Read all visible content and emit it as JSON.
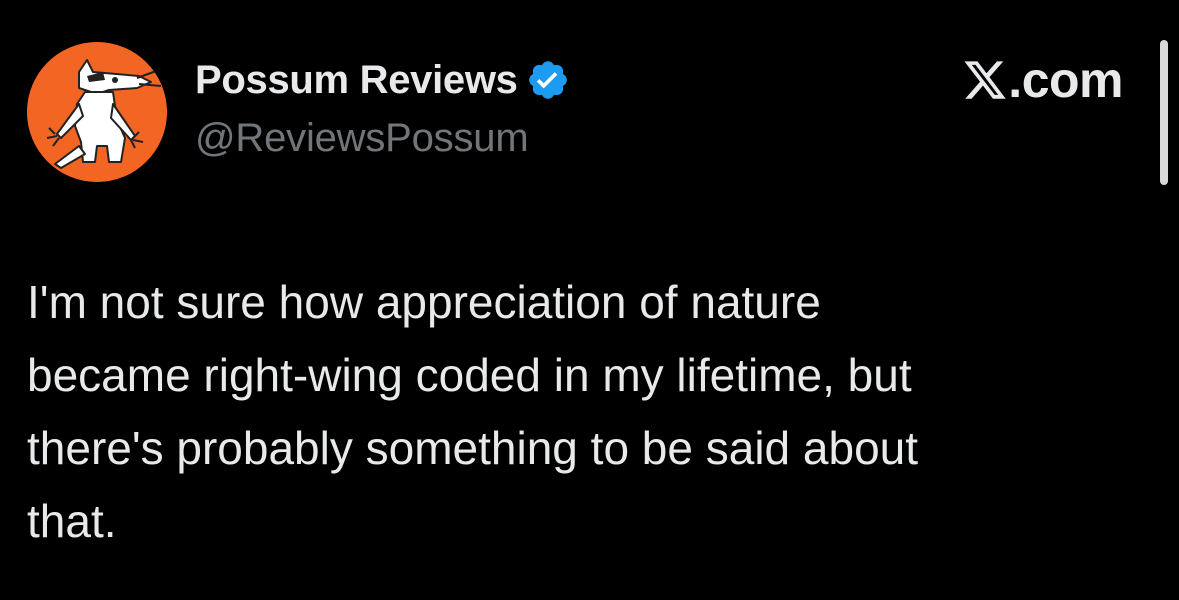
{
  "author": {
    "display_name": "Possum Reviews",
    "handle": "@ReviewsPossum",
    "verified": true,
    "avatar_icon": "possum-avatar-icon",
    "avatar_bg": "#f26522"
  },
  "source": {
    "domain": ".com",
    "logo_icon": "x-logo-icon"
  },
  "tweet": {
    "lines": [
      "I'm not sure how appreciation of nature",
      "became right-wing coded in my lifetime, but",
      "there's probably something to be said about",
      "that."
    ]
  },
  "colors": {
    "background": "#000000",
    "text_primary": "#e7e9ea",
    "text_secondary": "#71767b",
    "verified_blue": "#1d9bf0"
  }
}
